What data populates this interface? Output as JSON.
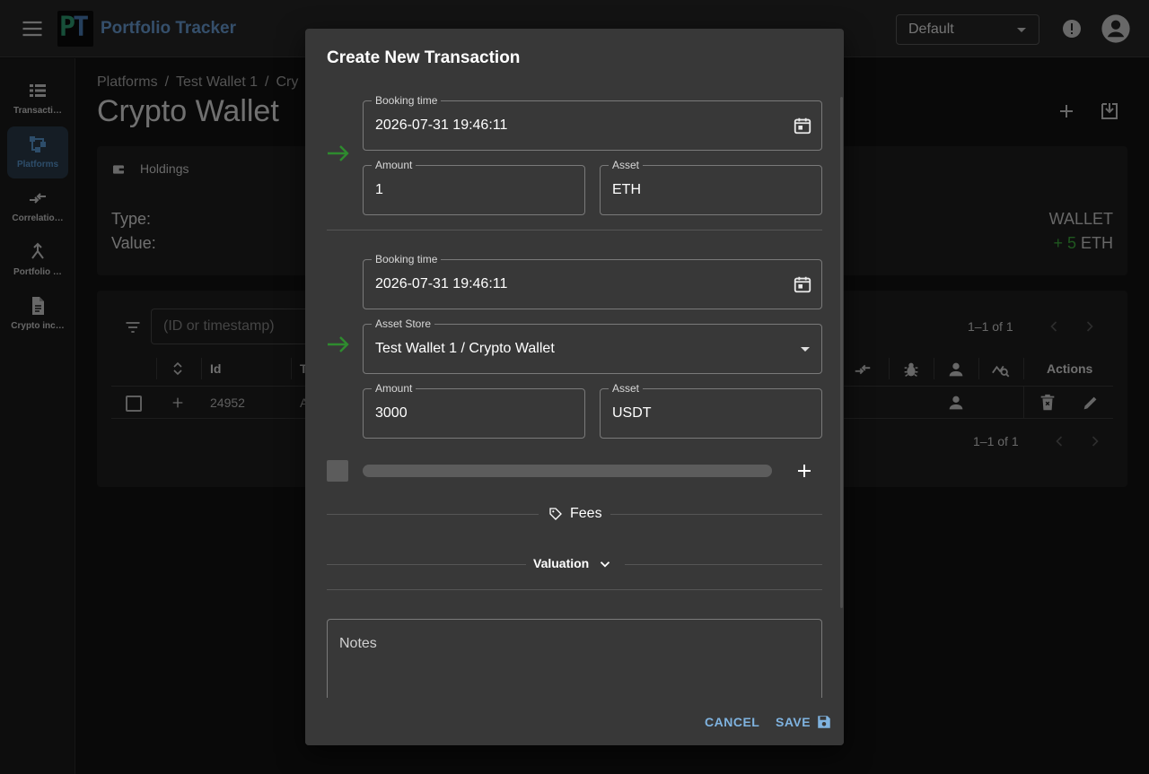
{
  "app": {
    "logo_p": "P",
    "logo_t": "T",
    "title": "Portfolio Tracker",
    "profile_select": "Default"
  },
  "sidebar": {
    "items": [
      {
        "label": "Transacti…",
        "icon": "list-icon"
      },
      {
        "label": "Platforms",
        "icon": "platforms-icon"
      },
      {
        "label": "Correlatio…",
        "icon": "compare-arrows-icon"
      },
      {
        "label": "Portfolio …",
        "icon": "merge-icon"
      },
      {
        "label": "Crypto inc…",
        "icon": "document-icon"
      }
    ]
  },
  "page": {
    "breadcrumb": [
      "Platforms",
      "Test Wallet 1",
      "Cry"
    ],
    "title": "Crypto Wallet"
  },
  "holdings": {
    "header": "Holdings",
    "type_label": "Type:",
    "value_label": "Value:",
    "type_value": "WALLET",
    "value_amount": "+ 5",
    "value_unit": "ETH"
  },
  "table": {
    "search_placeholder": "(ID or timestamp)",
    "pager": "1–1 of 1",
    "columns": {
      "id": "Id",
      "t": "T",
      "actions": "Actions"
    },
    "rows": [
      {
        "id": "24952",
        "t": "A"
      }
    ]
  },
  "dialog": {
    "title": "Create New Transaction",
    "leg1": {
      "booking_time_label": "Booking time",
      "booking_time": "2026-07-31 19:46:11",
      "amount_label": "Amount",
      "amount": "1",
      "asset_label": "Asset",
      "asset": "ETH"
    },
    "leg2": {
      "booking_time_label": "Booking time",
      "booking_time": "2026-07-31 19:46:11",
      "asset_store_label": "Asset Store",
      "asset_store": "Test Wallet 1 / Crypto Wallet",
      "amount_label": "Amount",
      "amount": "3000",
      "asset_label": "Asset",
      "asset": "USDT"
    },
    "fees_label": "Fees",
    "valuation_label": "Valuation",
    "notes_placeholder": "Notes",
    "cancel_label": "CANCEL",
    "save_label": "SAVE"
  },
  "colors": {
    "accent": "#7fb3e0",
    "positive": "#3eae3e",
    "arrow_green": "#2e8b2e"
  }
}
